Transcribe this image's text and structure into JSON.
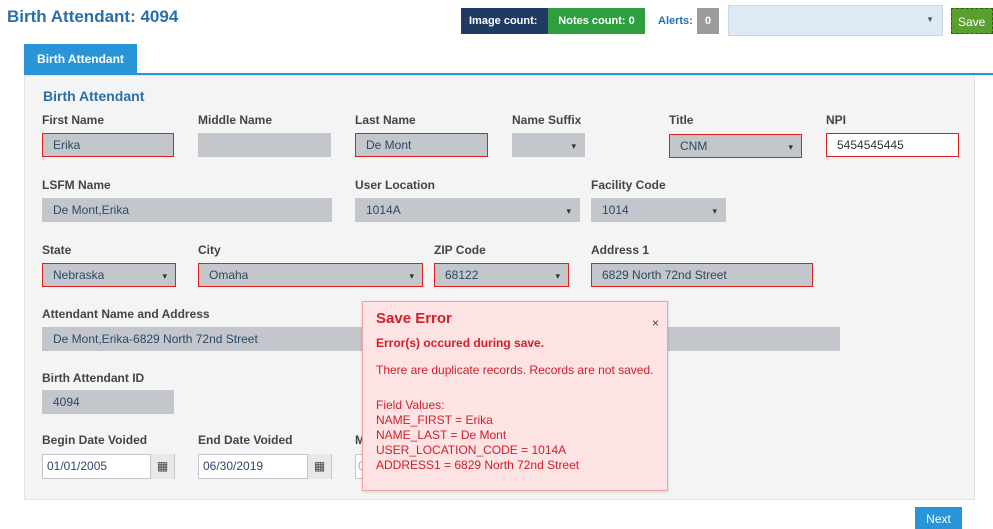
{
  "header": {
    "title": "Birth Attendant: 4094",
    "image_count": "Image count: 0",
    "notes_count": "Notes count: 0",
    "alerts_label": "Alerts:",
    "alerts_count": "0",
    "save_label": "Save"
  },
  "tabs": [
    {
      "label": "Birth Attendant"
    }
  ],
  "section_title": "Birth Attendant",
  "fields": {
    "first_name": {
      "label": "First Name",
      "value": "Erika"
    },
    "middle_name": {
      "label": "Middle Name",
      "value": ""
    },
    "last_name": {
      "label": "Last Name",
      "value": "De Mont"
    },
    "name_suffix": {
      "label": "Name Suffix",
      "value": ""
    },
    "title": {
      "label": "Title",
      "value": "CNM"
    },
    "npi": {
      "label": "NPI",
      "value": "5454545445"
    },
    "lsfm_name": {
      "label": "LSFM Name",
      "value": "De Mont,Erika"
    },
    "user_location": {
      "label": "User Location",
      "value": "1014A"
    },
    "facility_code": {
      "label": "Facility Code",
      "value": "1014"
    },
    "state": {
      "label": "State",
      "value": "Nebraska"
    },
    "city": {
      "label": "City",
      "value": "Omaha"
    },
    "zip_code": {
      "label": "ZIP Code",
      "value": "68122"
    },
    "address1": {
      "label": "Address 1",
      "value": "6829 North 72nd Street"
    },
    "attendant_name_address": {
      "label": "Attendant Name and Address",
      "value": "De Mont,Erika-6829 North 72nd Street"
    },
    "birth_attendant_id": {
      "label": "Birth Attendant ID",
      "value": "4094"
    },
    "begin_date_voided": {
      "label": "Begin Date Voided",
      "value": "01/01/2005"
    },
    "end_date_voided": {
      "label": "End Date Voided",
      "value": "06/30/2019"
    },
    "hidden_field_label_initial": "M",
    "hidden_field_value_initial": "0"
  },
  "error_dialog": {
    "title": "Save Error",
    "close_glyph": "×",
    "subtitle": "Error(s) occured during save.",
    "message": "There are duplicate records. Records are not saved.",
    "field_values_heading": "Field Values:",
    "field_values": [
      "NAME_FIRST = Erika",
      "NAME_LAST = De Mont",
      "USER_LOCATION_CODE = 1014A",
      "ADDRESS1 = 6829 North 72nd Street"
    ]
  },
  "footer": {
    "next_label": "Next"
  },
  "icons": {
    "dropdown": "chevron-down-icon",
    "calendar": "calendar-icon",
    "close": "close-icon"
  },
  "colors": {
    "brand_blue": "#2994d8",
    "title_blue": "#2a6fa8",
    "error_red": "#d0202a",
    "error_bg": "#fde3e3",
    "notes_green": "#2e9e3e",
    "image_navy": "#1f3b63"
  }
}
